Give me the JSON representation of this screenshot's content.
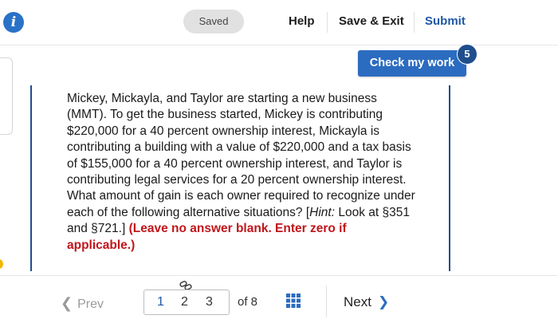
{
  "header": {
    "info_icon_glyph": "i",
    "saved_label": "Saved",
    "help_label": "Help",
    "save_exit_label": "Save & Exit",
    "submit_label": "Submit"
  },
  "check": {
    "label": "Check my work",
    "badge_count": "5"
  },
  "question": {
    "text": "Mickey, Mickayla, and Taylor are starting a new business (MMT). To get the business started, Mickey is contributing $220,000 for a 40 percent ownership interest, Mickayla is contributing a building with a value of $220,000 and a tax basis of $155,000 for a 40 percent ownership interest, and Taylor is contributing legal services for a 20 percent ownership interest. What amount of gain is each owner required to recognize under each of the following alternative situations? [",
    "hint_label": "Hint:",
    "hint_text": " Look at §351 and §721.] ",
    "warning": "(Leave no answer blank. Enter zero if applicable.)"
  },
  "pager": {
    "prev_label": "Prev",
    "pages": [
      "1",
      "2",
      "3"
    ],
    "of_label": "of 8",
    "next_label": "Next"
  },
  "icons": {
    "info": "info-icon",
    "link": "link-icon",
    "grid": "grid-icon",
    "prev": "chevron-left-icon",
    "next": "chevron-right-icon"
  },
  "colors": {
    "accent": "#2b6cc0",
    "submit": "#1f58a6",
    "warning": "#c0161b",
    "rule": "#1f4e8c"
  }
}
